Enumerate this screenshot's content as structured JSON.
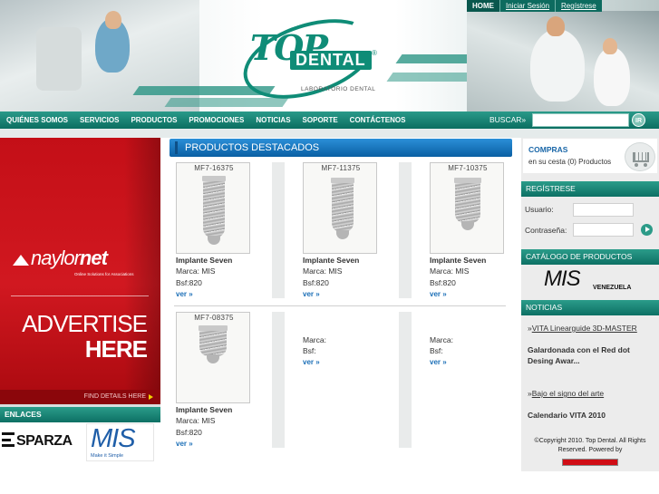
{
  "header": {
    "top_links": [
      "HOME",
      "Iniciar Sesión",
      "Regístrese"
    ],
    "logo": {
      "brand_top": "TOP",
      "brand_main": "DENTAL",
      "registered": "®",
      "subtitle": "LABORATORIO DENTAL"
    }
  },
  "nav": {
    "items": [
      "QUIÉNES SOMOS",
      "SERVICIOS",
      "PRODUCTOS",
      "PROMOCIONES",
      "NOTICIAS",
      "SOPORTE",
      "CONTÁCTENOS"
    ],
    "search_label": "BUSCAR»",
    "search_placeholder": "",
    "search_button": "IR"
  },
  "banner": {
    "brand_prefix": "naylor",
    "brand_suffix": "net",
    "tagline": "Online Solutions for Associations",
    "line1": "ADVERTISE",
    "line2": "HERE",
    "cta": "FIND DETAILS HERE"
  },
  "enlaces": {
    "title": "ENLACES",
    "esparza": "SPARZA",
    "mis_title": "MIS",
    "mis_slogan": "Make it Simple"
  },
  "products": {
    "title": "PRODUCTOS DESTACADOS",
    "items": [
      {
        "code": "MF7-16375",
        "name": "Implante Seven",
        "brand": "Marca: MIS",
        "price": "Bsf:820",
        "link": "ver »"
      },
      {
        "code": "MF7-11375",
        "name": "Implante Seven",
        "brand": "Marca: MIS",
        "price": "Bsf:820",
        "link": "ver »"
      },
      {
        "code": "MF7-10375",
        "name": "Implante Seven",
        "brand": "Marca: MIS",
        "price": "Bsf:820",
        "link": "ver »"
      },
      {
        "code": "MF7-08375",
        "name": "Implante Seven",
        "brand": "Marca: MIS",
        "price": "Bsf:820",
        "link": "ver »"
      },
      {
        "code": "",
        "name": "",
        "brand": "Marca:",
        "price": "Bsf:",
        "link": "ver »"
      },
      {
        "code": "",
        "name": "",
        "brand": "Marca:",
        "price": "Bsf:",
        "link": "ver »"
      }
    ]
  },
  "sidebar": {
    "compras": {
      "title": "COMPRAS",
      "status": "en su cesta (0) Productos"
    },
    "registro": {
      "title": "REGÍSTRESE",
      "user_label": "Usuario:",
      "password_label": "Contraseña:"
    },
    "catalogo": {
      "title": "CATÁLOGO DE PRODUCTOS",
      "brand": "MIS",
      "country": "VENEZUELA"
    },
    "noticias": {
      "title": "NOTICIAS",
      "items": [
        {
          "link": "VITA Linearguide 3D-MASTER",
          "summary": "Galardonada con el Red dot Desing Awar..."
        },
        {
          "link": "Bajo el signo del arte",
          "summary": "Calendario VITA 2010"
        }
      ]
    },
    "copyright": "©Copyright 2010. Top Dental. All Rights Reserved. Powered by"
  },
  "colors": {
    "teal": "#0d7064",
    "blue": "#0a5fa3",
    "red": "#c40f17",
    "link_blue": "#1c6fb7"
  }
}
